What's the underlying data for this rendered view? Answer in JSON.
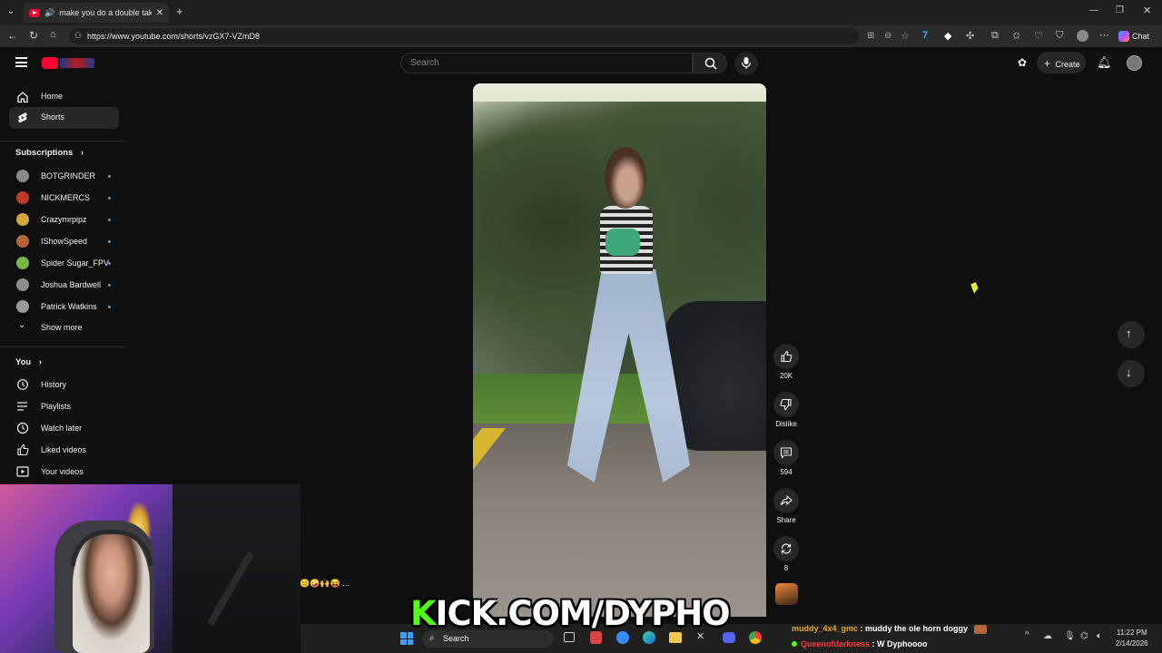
{
  "browser": {
    "tab_title": "make you do a double take 🍊",
    "url": "https://www.youtube.com/shorts/vzGX7-VZmD8",
    "chat_button": "Chat",
    "window_controls": [
      "minimize-icon",
      "restore-icon",
      "close-icon"
    ]
  },
  "youtube": {
    "search_placeholder": "Search",
    "create_label": "Create",
    "nav": [
      {
        "label": "Home",
        "icon": "home-icon"
      },
      {
        "label": "Shorts",
        "icon": "shorts-icon"
      }
    ],
    "subscriptions_title": "Subscriptions",
    "subscriptions": [
      {
        "label": "BOTGRINDER",
        "color": "#8a8a8a"
      },
      {
        "label": "NICKMERCS",
        "color": "#c0392b"
      },
      {
        "label": "Crazymrpipz",
        "color": "#d4a53a"
      },
      {
        "label": "IShowSpeed",
        "color": "#b5653a"
      },
      {
        "label": "Spider Sugar_FPV",
        "color": "#7ab648"
      },
      {
        "label": "Joshua Bardwell",
        "color": "#8d8d8d"
      },
      {
        "label": "Patrick Watkins",
        "color": "#9a9a9a"
      }
    ],
    "show_more": "Show more",
    "you_title": "You",
    "you_items": [
      {
        "label": "History",
        "icon": "history-icon"
      },
      {
        "label": "Playlists",
        "icon": "playlists-icon"
      },
      {
        "label": "Watch later",
        "icon": "watch-later-icon"
      },
      {
        "label": "Liked videos",
        "icon": "liked-videos-icon"
      },
      {
        "label": "Your videos",
        "icon": "your-videos-icon"
      }
    ],
    "actions": {
      "likes": "20K",
      "dislike": "Dislike",
      "comments": "594",
      "share": "Share",
      "remix": "8"
    }
  },
  "overlay": {
    "kick_k": "K",
    "kick_rest": "ICK.COM/DYPHO",
    "chat": [
      {
        "user": "muddy_4x4_gmc",
        "message": " : muddy the ole horn doggy",
        "user_color": "#e8a33c"
      },
      {
        "user": "Queenofdarkness",
        "message": " : W Dyphoooo",
        "user_color": "#ff3b3b"
      }
    ],
    "emoji_row": "😊🤪🙌😝 ..."
  },
  "taskbar": {
    "search": "Search",
    "time": "11:22 PM",
    "date": "2/14/2026"
  }
}
